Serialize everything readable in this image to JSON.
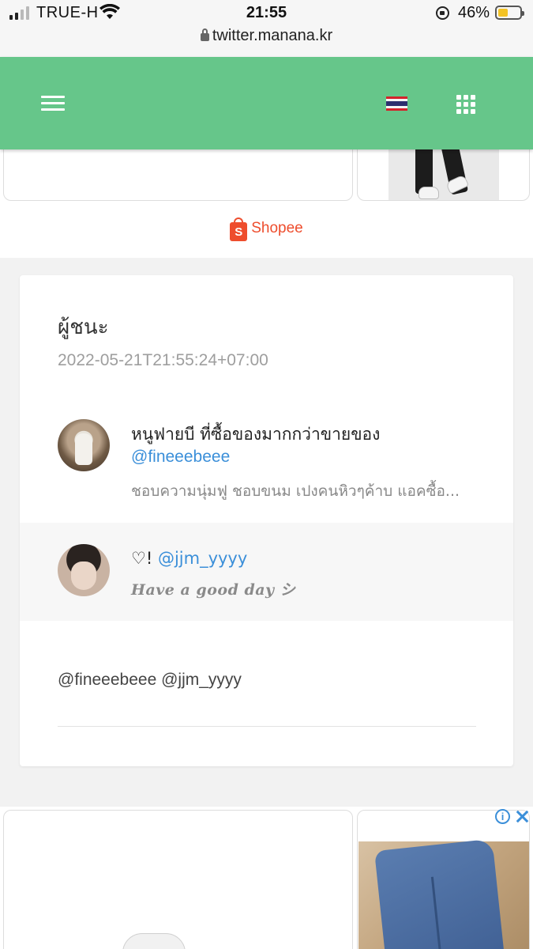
{
  "status_bar": {
    "carrier": "TRUE-H",
    "time": "21:55",
    "battery_percent": "46%",
    "battery_level": 0.46,
    "url": "twitter.manana.kr"
  },
  "header": {
    "menu_icon": "hamburger-menu-icon",
    "language_icon": "thai-flag-icon",
    "apps_icon": "grid-apps-icon",
    "background_color": "#66c68a"
  },
  "top_ad": {
    "shopee_label": "Shopee",
    "shopee_bag_letter": "S",
    "brand_color": "#ee4d2d"
  },
  "card": {
    "title": "ผู้ชนะ",
    "date": "2022-05-21T21:55:24+07:00",
    "users": [
      {
        "name": "หนูฟายบี ที่ซื้อของมากกว่าขายของ",
        "handle": "@fineeebeee",
        "description": "ชอบความนุ่มฟู ชอบขนม เปงคนหิวๆค้าบ แอคซื้อ..."
      },
      {
        "name": "♡!",
        "handle": "@jjm_yyyy",
        "description": "Have a good day シ"
      }
    ],
    "mentions": "@fineeebeee @jjm_yyyy"
  },
  "bottom_ad": {
    "info_icon_glyph": "i",
    "link_color": "#3b8fd9"
  }
}
